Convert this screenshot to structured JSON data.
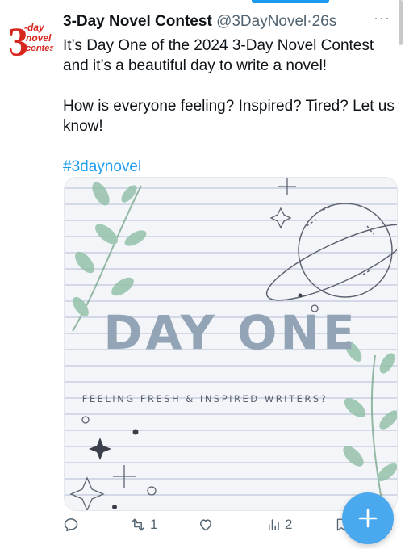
{
  "tweet": {
    "author_name": "3-Day Novel Contest",
    "handle": "@3DayNovel",
    "separator": "·",
    "time": "26s",
    "more": "···",
    "avatar_text": [
      "3",
      "-day",
      "novel",
      "contest"
    ],
    "line1": "It’s Day One of the 2024 3-Day Novel Contest and it’s a beautiful day to write a novel!",
    "line2": "How is everyone feeling? Inspired? Tired? Let us know!",
    "hashtag": "#3daynovel"
  },
  "media": {
    "title": "DAY ONE",
    "subtitle": "FEELING FRESH & INSPIRED WRITERS?"
  },
  "actions": {
    "retweet_count": "1",
    "views_count": "2"
  },
  "colors": {
    "accent": "#1d9bf0",
    "fab": "#4aa8ee",
    "muted": "#536471",
    "title": "#93a4b6"
  },
  "icons": [
    "reply-icon",
    "retweet-icon",
    "like-icon",
    "views-icon",
    "bookmark-icon",
    "share-icon",
    "compose-plus-icon"
  ]
}
